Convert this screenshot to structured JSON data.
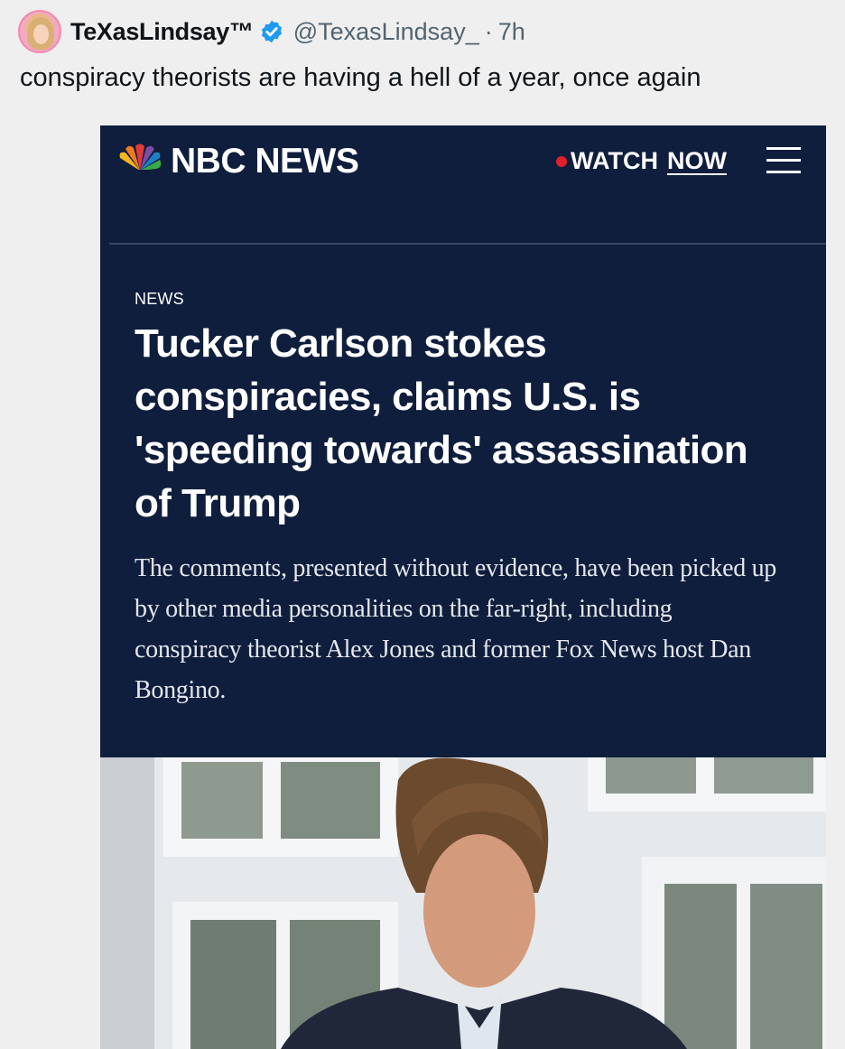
{
  "tweet": {
    "display_name": "TeXasLindsay™",
    "handle": "@TexasLindsay_",
    "separator": "·",
    "time": "7h",
    "text": "conspiracy theorists are having a hell of a year, once again"
  },
  "card": {
    "brand": "NBC NEWS",
    "watch": "WATCH",
    "now": "NOW",
    "section": "NEWS",
    "headline": "Tucker Carlson stokes conspiracies, claims U.S. is 'speeding towards' assassination of Trump",
    "dek": "The comments, presented without evidence, have been picked up by other media personalities on the far-right, including conspiracy theorist Alex Jones and former Fox News host Dan Bongino."
  },
  "colors": {
    "card_bg": "#0f1e3d",
    "verified_blue": "#1d9bf0",
    "live_red": "#e0202c"
  }
}
